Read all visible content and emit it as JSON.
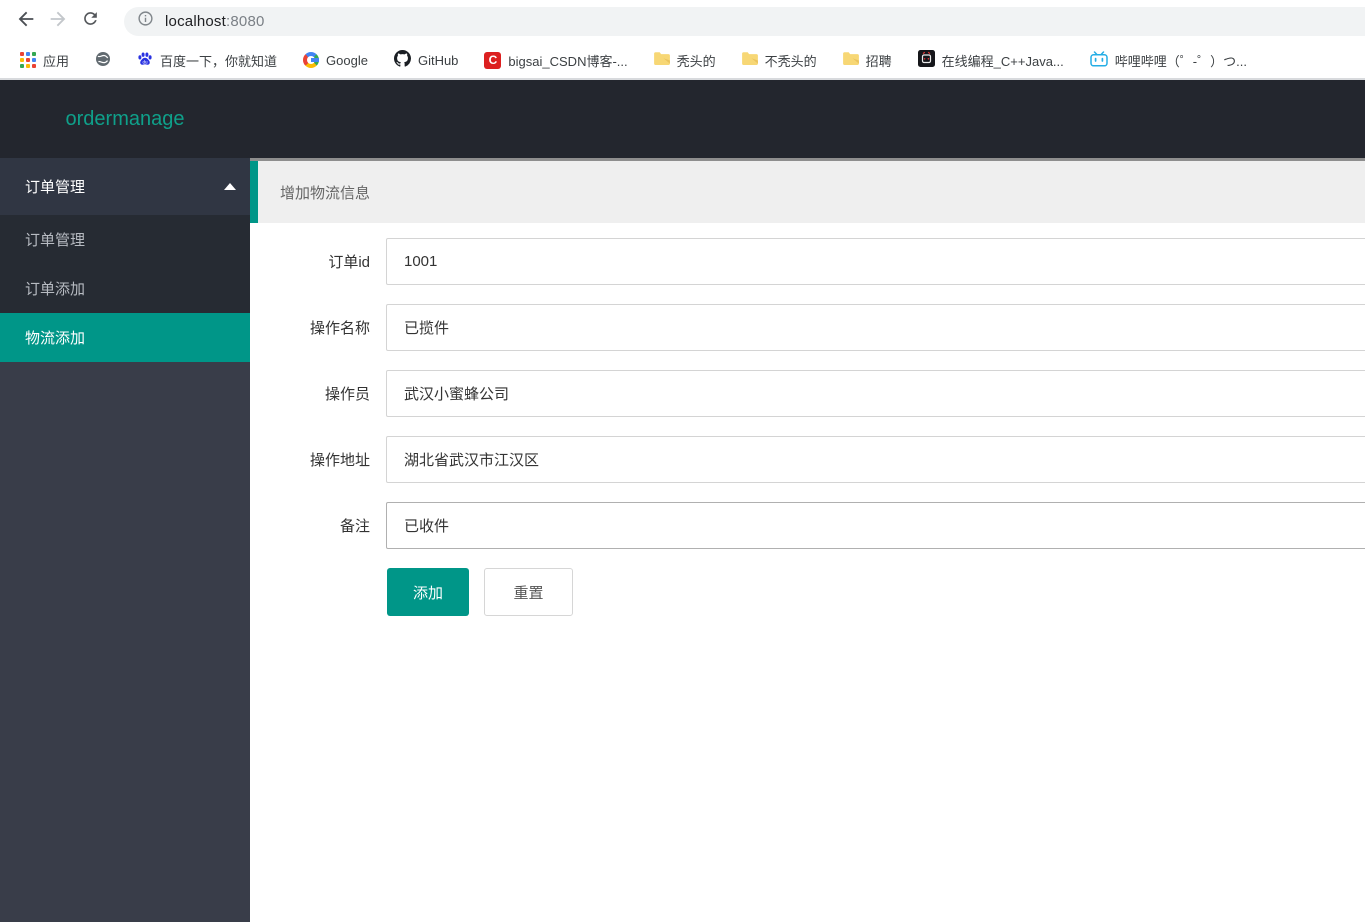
{
  "browser": {
    "url": {
      "host": "localhost",
      "port": ":8080"
    },
    "bookmarks": [
      {
        "label": "应用",
        "icon": "apps-grid-icon"
      },
      {
        "label": "",
        "icon": "globe-icon"
      },
      {
        "label": "百度一下，你就知道",
        "icon": "baidu-icon"
      },
      {
        "label": "Google",
        "icon": "google-icon"
      },
      {
        "label": "GitHub",
        "icon": "github-icon"
      },
      {
        "label": "bigsai_CSDN博客-...",
        "icon": "csdn-icon"
      },
      {
        "label": "秃头的",
        "icon": "folder-icon"
      },
      {
        "label": "不秃头的",
        "icon": "folder-icon"
      },
      {
        "label": "招聘",
        "icon": "folder-icon"
      },
      {
        "label": "在线编程_C++Java...",
        "icon": "code-site-icon"
      },
      {
        "label": "哔哩哔哩（゜-゜）つ...",
        "icon": "bilibili-icon"
      }
    ]
  },
  "app": {
    "logo": "ordermanage",
    "sidebar": {
      "parent": {
        "label": "订单管理",
        "expanded": true
      },
      "items": [
        {
          "label": "订单管理",
          "active": false
        },
        {
          "label": "订单添加",
          "active": false
        },
        {
          "label": "物流添加",
          "active": true
        }
      ]
    },
    "page_title": "增加物流信息",
    "form": {
      "fields": [
        {
          "label": "订单id",
          "value": "1001"
        },
        {
          "label": "操作名称",
          "value": "已揽件"
        },
        {
          "label": "操作员",
          "value": "武汉小蜜蜂公司"
        },
        {
          "label": "操作地址",
          "value": "湖北省武汉市江汉区"
        },
        {
          "label": "备注",
          "value": "已收件"
        }
      ],
      "submit_label": "添加",
      "reset_label": "重置"
    }
  },
  "colors": {
    "accent": "#009688",
    "logo_text": "#0fa08a",
    "header_bg": "#23262e",
    "sidebar_bg": "#393d49",
    "submenu_bg": "#262b33",
    "active_item_bg": "#009688",
    "title_bar_bg": "#efefef"
  }
}
